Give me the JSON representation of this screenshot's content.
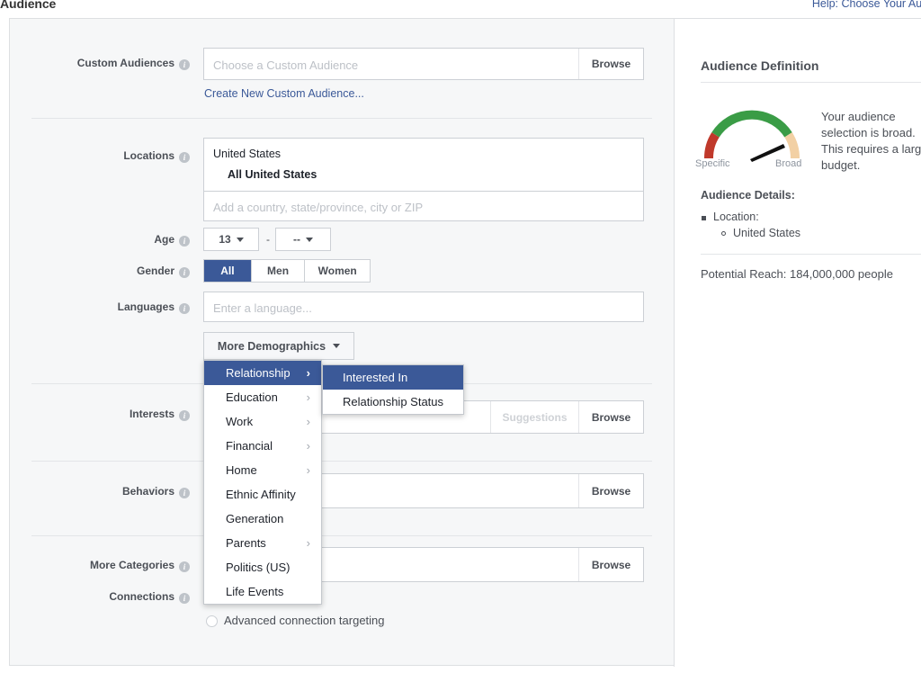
{
  "header": {
    "title": "Audience",
    "help_link": "Help: Choose Your Audience"
  },
  "form": {
    "custom_audiences": {
      "label": "Custom Audiences",
      "placeholder": "Choose a Custom Audience",
      "browse_label": "Browse",
      "create_link": "Create New Custom Audience..."
    },
    "locations": {
      "label": "Locations",
      "country": "United States",
      "scope": "All United States",
      "placeholder": "Add a country, state/province, city or ZIP"
    },
    "age": {
      "label": "Age",
      "min": "13",
      "max": "--",
      "separator": "-"
    },
    "gender": {
      "label": "Gender",
      "options": [
        "All",
        "Men",
        "Women"
      ],
      "selected": "All"
    },
    "languages": {
      "label": "Languages",
      "placeholder": "Enter a language..."
    },
    "more_demographics": {
      "button_label": "More Demographics"
    },
    "interests": {
      "label": "Interests",
      "suggestions_label": "Suggestions",
      "browse_label": "Browse"
    },
    "behaviors": {
      "label": "Behaviors",
      "browse_label": "Browse"
    },
    "more_categories": {
      "label": "More Categories",
      "browse_label": "Browse"
    },
    "connections": {
      "label": "Connections",
      "advanced_label": "Advanced connection targeting"
    }
  },
  "menu": {
    "items": [
      {
        "label": "Relationship",
        "has_submenu": true,
        "selected": true
      },
      {
        "label": "Education",
        "has_submenu": true,
        "selected": false
      },
      {
        "label": "Work",
        "has_submenu": true,
        "selected": false
      },
      {
        "label": "Financial",
        "has_submenu": true,
        "selected": false
      },
      {
        "label": "Home",
        "has_submenu": true,
        "selected": false
      },
      {
        "label": "Ethnic Affinity",
        "has_submenu": false,
        "selected": false
      },
      {
        "label": "Generation",
        "has_submenu": false,
        "selected": false
      },
      {
        "label": "Parents",
        "has_submenu": true,
        "selected": false
      },
      {
        "label": "Politics (US)",
        "has_submenu": false,
        "selected": false
      },
      {
        "label": "Life Events",
        "has_submenu": false,
        "selected": false
      }
    ],
    "arrow_glyph": "›",
    "submenu": {
      "items": [
        {
          "label": "Interested In",
          "selected": true
        },
        {
          "label": "Relationship Status",
          "selected": false
        }
      ]
    }
  },
  "sidebar": {
    "title": "Audience Definition",
    "gauge": {
      "left_label": "Specific",
      "right_label": "Broad",
      "colors": {
        "red": "#c0392b",
        "green": "#3a9c46",
        "tan": "#f2d0a4",
        "needle": "#111111"
      }
    },
    "summary": "Your audience selection is broad. This requires a large budget.",
    "details_title": "Audience Details:",
    "details": {
      "category": "Location:",
      "value": "United States"
    },
    "reach": "Potential Reach: 184,000,000 people"
  },
  "colors": {
    "accent": "#3b5998",
    "panel_bg": "#f6f7f8",
    "border": "#dddfe2",
    "label": "#4b4f56"
  }
}
